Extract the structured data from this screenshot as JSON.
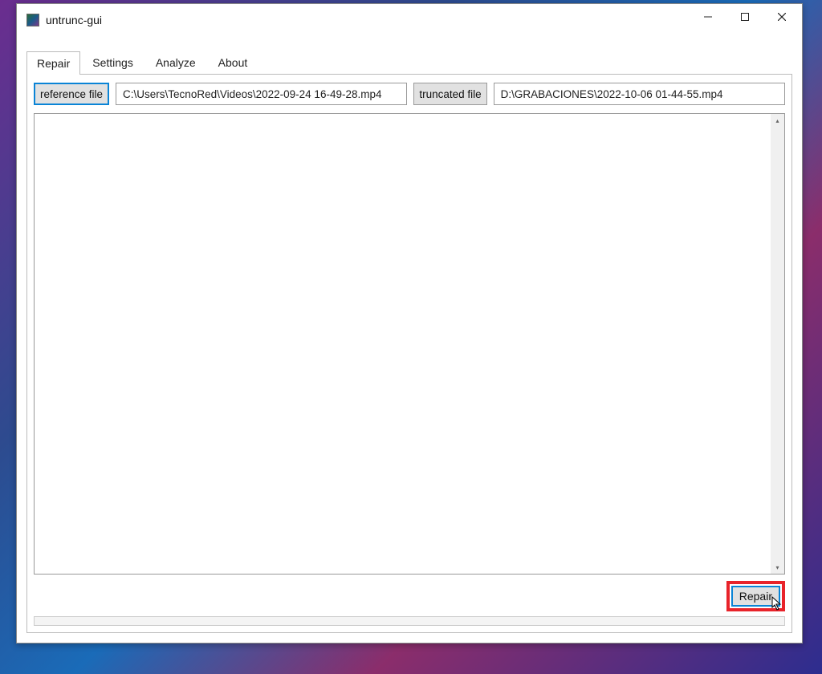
{
  "window": {
    "title": "untrunc-gui"
  },
  "tabs": {
    "items": [
      {
        "label": "Repair",
        "active": true
      },
      {
        "label": "Settings",
        "active": false
      },
      {
        "label": "Analyze",
        "active": false
      },
      {
        "label": "About",
        "active": false
      }
    ]
  },
  "repair_tab": {
    "reference_button": "reference file",
    "reference_path": "C:\\Users\\TecnoRed\\Videos\\2022-09-24 16-49-28.mp4",
    "truncated_button": "truncated file",
    "truncated_path": "D:\\GRABACIONES\\2022-10-06 01-44-55.mp4",
    "output_text": "",
    "repair_button": "Repair"
  }
}
